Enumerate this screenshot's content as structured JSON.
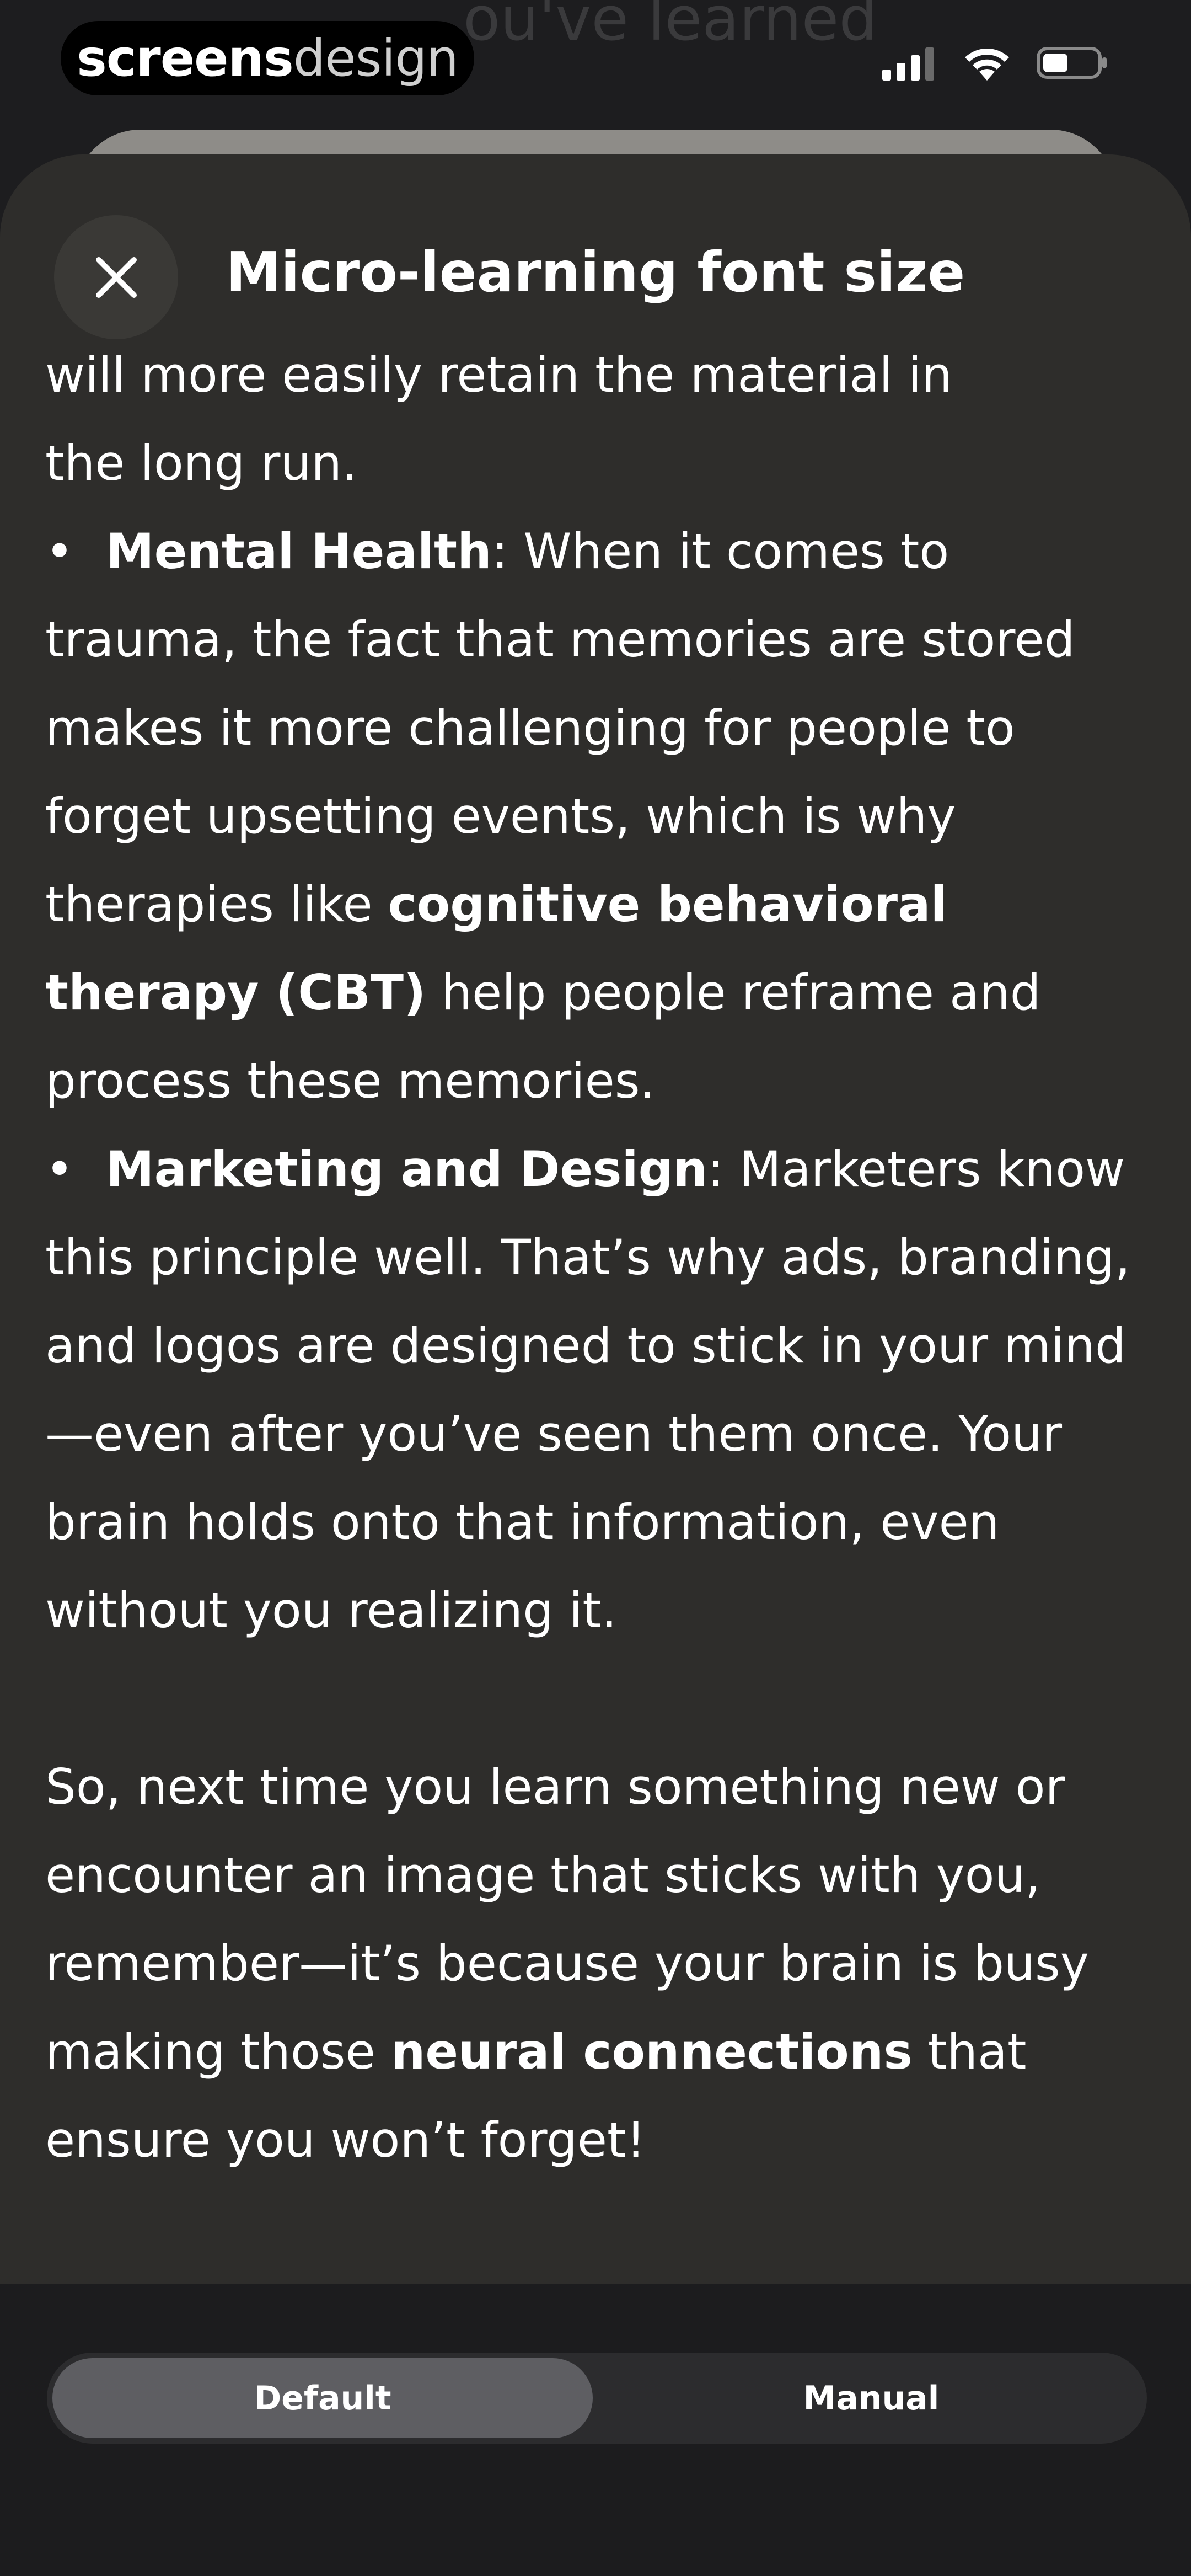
{
  "status_bar": {
    "brand_bold": "screens",
    "brand_light": "design",
    "icons": [
      "signal-icon",
      "wifi-icon",
      "battery-icon"
    ]
  },
  "background": {
    "partial_title": "ou've learned"
  },
  "sheet": {
    "title": "Micro-learning font size",
    "close_icon": "close-icon",
    "content": {
      "intro_line1": "will more easily retain the material in",
      "intro_line2": "the long run.",
      "bullets": [
        {
          "label": "Mental Health",
          "text1": ": When it comes to trauma, the fact that memories are stored makes it more challenging for people to forget upsetting events, which is why therapies like ",
          "bold2": "cognitive behavioral therapy (CBT)",
          "text2": " help people reframe and process these memories."
        },
        {
          "label": "Marketing and Design",
          "text1": ": Marketers know this principle well. That’s why ads, branding, and logos are designed to stick in your mind—even after you’ve seen them once. Your brain holds onto that information, even without you realizing it."
        }
      ],
      "closing_text": "So, next time you learn something new or encounter an image that sticks with you, remember—it’s because your brain is busy making those ",
      "closing_bold": "neural connections",
      "closing_end": " that ensure you won’t forget!"
    }
  },
  "font_size_selector": {
    "options": [
      {
        "label": "Default",
        "selected": true
      },
      {
        "label": "Manual",
        "selected": false
      }
    ]
  },
  "colors": {
    "sheet_background": "#2e2d2b",
    "bottom_background": "#1c1c1e",
    "selected_segment": "#5e5e62"
  }
}
